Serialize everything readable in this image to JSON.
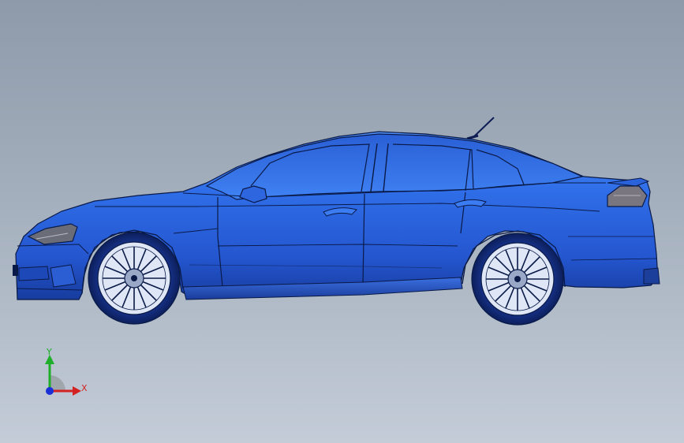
{
  "viewport": {
    "background_top": "#8e9aaa",
    "background_bottom": "#c3ccd7",
    "model_color": "#2f6ee8",
    "edge_color": "#0a1a48"
  },
  "triad": {
    "y_label": "Y",
    "x_label": "X",
    "y_color": "#1fae2a",
    "x_color": "#d32222",
    "z_color": "#1b2fd6"
  }
}
